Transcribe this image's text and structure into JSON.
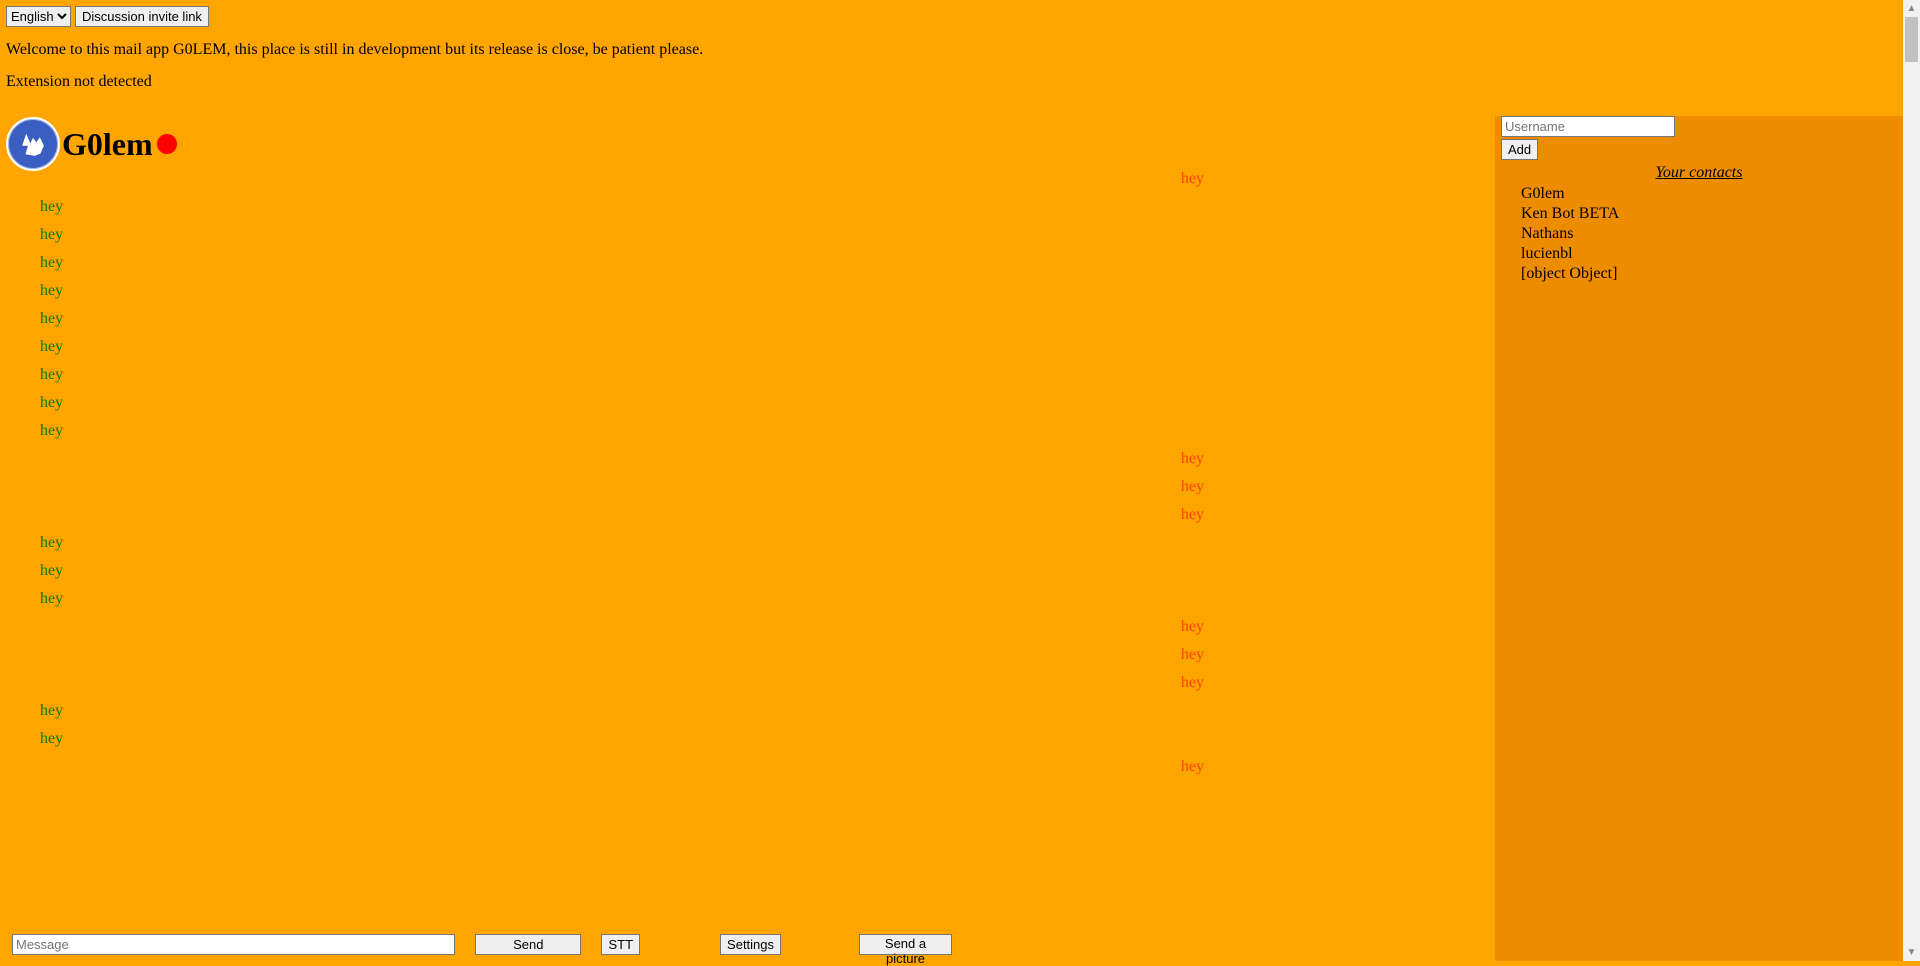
{
  "language_select": {
    "options": [
      "English"
    ],
    "selected": "English"
  },
  "discussion_invite_btn": "Discussion invite link",
  "welcome_text": "Welcome to this mail app G0LEM, this place is still in development but its release is close, be patient please.",
  "ext_status": "Extension not detected",
  "chat_title": "G0lem",
  "status": "offline",
  "status_color": "red",
  "contacts": {
    "username_placeholder": "Username",
    "add_btn": "Add",
    "title": "Your contacts",
    "items": [
      "G0lem",
      "Ken Bot BETA",
      "Nathans",
      "lucienbl",
      "[object Object]"
    ]
  },
  "messages": [
    {
      "side": "received",
      "text": "hey"
    },
    {
      "side": "sent",
      "text": "hey"
    },
    {
      "side": "sent",
      "text": "hey"
    },
    {
      "side": "sent",
      "text": "hey"
    },
    {
      "side": "sent",
      "text": "hey"
    },
    {
      "side": "sent",
      "text": "hey"
    },
    {
      "side": "sent",
      "text": "hey"
    },
    {
      "side": "sent",
      "text": "hey"
    },
    {
      "side": "sent",
      "text": "hey"
    },
    {
      "side": "sent",
      "text": "hey"
    },
    {
      "side": "received",
      "text": "hey"
    },
    {
      "side": "received",
      "text": "hey"
    },
    {
      "side": "received",
      "text": "hey"
    },
    {
      "side": "sent",
      "text": "hey"
    },
    {
      "side": "sent",
      "text": "hey"
    },
    {
      "side": "sent",
      "text": "hey"
    },
    {
      "side": "received",
      "text": "hey"
    },
    {
      "side": "received",
      "text": "hey"
    },
    {
      "side": "received",
      "text": "hey"
    },
    {
      "side": "sent",
      "text": "hey"
    },
    {
      "side": "sent",
      "text": "hey"
    },
    {
      "side": "received",
      "text": "hey"
    }
  ],
  "input": {
    "message_placeholder": "Message",
    "send_btn": "Send",
    "stt_btn": "STT",
    "settings_btn": "Settings",
    "send_picture_btn": "Send a picture"
  }
}
